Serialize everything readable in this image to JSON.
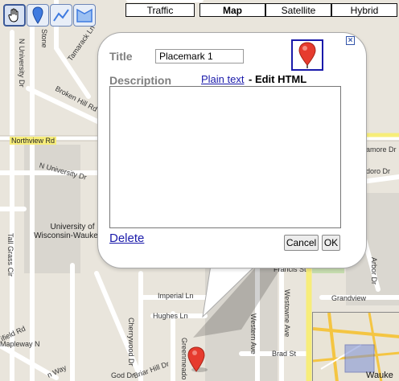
{
  "toolbar": {
    "tools": [
      {
        "name": "hand-icon",
        "active": true
      },
      {
        "name": "placemark-icon",
        "active": false
      },
      {
        "name": "line-icon",
        "active": false
      },
      {
        "name": "shape-icon",
        "active": false
      }
    ]
  },
  "map_types": {
    "traffic": "Traffic",
    "map": "Map",
    "satellite": "Satellite",
    "hybrid": "Hybrid",
    "selected": "Map"
  },
  "map": {
    "streets": {
      "n_university": "N University Dr",
      "stone": "Stone",
      "tamarack": "Tamarack Ln",
      "broken_hill": "Broken Hill Rd",
      "northview": "Northview Rd",
      "n_university_2": "N University Dr",
      "tall_grass": "Tall Grass Cir",
      "springfield": "ifield Rd",
      "mapleway": "Mapleway N",
      "imperial": "Imperial Ln",
      "hughes": "Hughes Ln",
      "cherrywood": "Cherrywood Dr",
      "briar_hill": "Briar Hill Dr",
      "god": "God Dr",
      "green_meadow": "Greenmeado",
      "francis": "Francis St",
      "westowne": "Westowne Ave",
      "western": "Western Ave",
      "brad": "Brad St",
      "linden": "n Way",
      "amore": "amore Dr",
      "pedoro": "doro Dr",
      "arbor": "Arbor Dr",
      "grandview_st": "Grandview",
      "waukesha": "Wauke"
    },
    "place_label": "University of\nWisconsin-Waukesha",
    "accent_highway": "#f7ed7a",
    "road_color": "#ffffff",
    "park_color": "#c8deb0"
  },
  "balloon": {
    "title_label": "Title",
    "title_value": "Placemark 1",
    "description_label": "Description",
    "plain_text_link": "Plain text",
    "edit_html_label": "- Edit HTML",
    "delete_link": "Delete",
    "cancel_button": "Cancel",
    "ok_button": "OK",
    "close_icon": "close-icon",
    "marker_color": "#e63b2e"
  }
}
